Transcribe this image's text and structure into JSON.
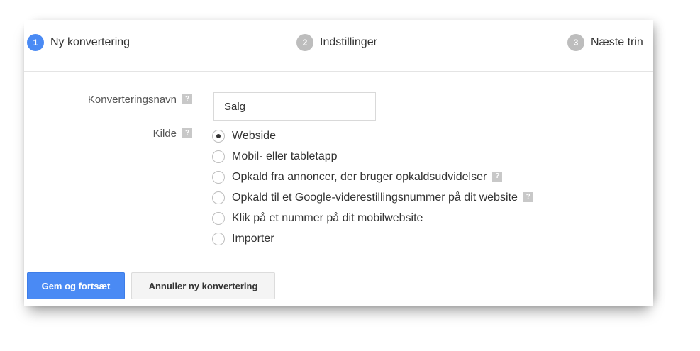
{
  "stepper": {
    "steps": [
      {
        "number": "1",
        "label": "Ny konvertering",
        "state": "active",
        "color": "#4a8af4"
      },
      {
        "number": "2",
        "label": "Indstillinger",
        "state": "inactive",
        "color": "#bdbdbd"
      },
      {
        "number": "3",
        "label": "Næste trin",
        "state": "inactive",
        "color": "#bdbdbd"
      }
    ]
  },
  "form": {
    "name_label": "Konverteringsnavn",
    "name_value": "Salg",
    "source_label": "Kilde",
    "help_icon": "?",
    "source_options": [
      {
        "label": "Webside",
        "checked": true,
        "has_help": false
      },
      {
        "label": "Mobil- eller tabletapp",
        "checked": false,
        "has_help": false
      },
      {
        "label": "Opkald fra annoncer, der bruger opkaldsudvidelser",
        "checked": false,
        "has_help": true
      },
      {
        "label": "Opkald til et Google-viderestillingsnummer på dit website",
        "checked": false,
        "has_help": true
      },
      {
        "label": "Klik på et nummer på dit mobilwebsite",
        "checked": false,
        "has_help": false
      },
      {
        "label": "Importer",
        "checked": false,
        "has_help": false
      }
    ]
  },
  "buttons": {
    "save_label": "Gem og fortsæt",
    "cancel_label": "Annuller ny konvertering"
  }
}
